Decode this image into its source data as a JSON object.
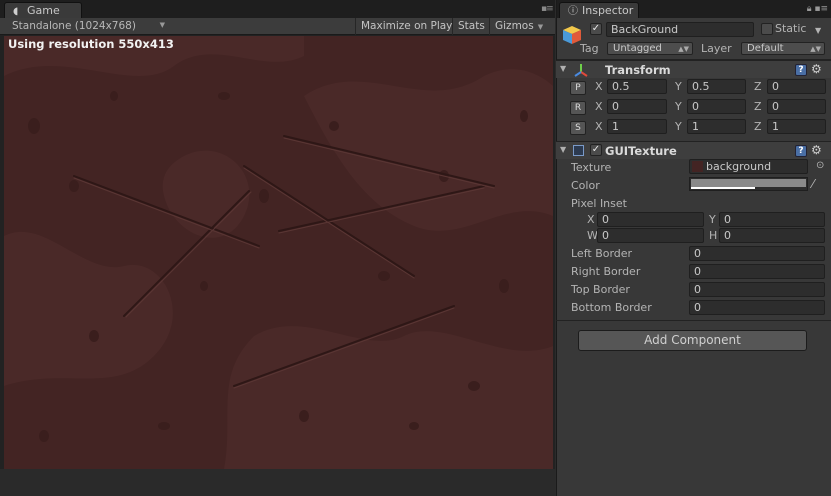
{
  "game": {
    "tab_label": "Game",
    "resolution_dropdown": "Standalone (1024x768)",
    "maximize_on_play": "Maximize on Play",
    "stats": "Stats",
    "gizmos": "Gizmos",
    "resolution_label": "Using resolution 550x413",
    "icons": [
      "pacman-icon",
      "tab-menu-icon",
      "dropdown-arrow-icon"
    ]
  },
  "inspector": {
    "tab_label": "Inspector",
    "object_name": "BackGround",
    "active": true,
    "static_label": "Static",
    "static_checked": false,
    "tag_label": "Tag",
    "tag_value": "Untagged",
    "layer_label": "Layer",
    "layer_value": "Default",
    "transform": {
      "title": "Transform",
      "position": {
        "btn": "P",
        "x": "0.5",
        "y": "0.5",
        "z": "0"
      },
      "rotation": {
        "btn": "R",
        "x": "0",
        "y": "0",
        "z": "0"
      },
      "scale": {
        "btn": "S",
        "x": "1",
        "y": "1",
        "z": "1"
      },
      "axis_x": "X",
      "axis_y": "Y",
      "axis_z": "Z"
    },
    "gui_texture": {
      "title": "GUITexture",
      "enabled": true,
      "texture_label": "Texture",
      "texture_value": "background",
      "color_label": "Color",
      "color_value": "#8a8a8a",
      "pixel_inset_label": "Pixel Inset",
      "inset_x_label": "X",
      "inset_x": "0",
      "inset_y_label": "Y",
      "inset_y": "0",
      "inset_w_label": "W",
      "inset_w": "0",
      "inset_h_label": "H",
      "inset_h": "0",
      "left_border_label": "Left Border",
      "left_border": "0",
      "right_border_label": "Right Border",
      "right_border": "0",
      "top_border_label": "Top Border",
      "top_border": "0",
      "bottom_border_label": "Bottom Border",
      "bottom_border": "0"
    },
    "add_component": "Add Component"
  },
  "colors": {
    "game_background": "#432423",
    "panel": "#383838",
    "accent_help": "#4a6fa5"
  }
}
